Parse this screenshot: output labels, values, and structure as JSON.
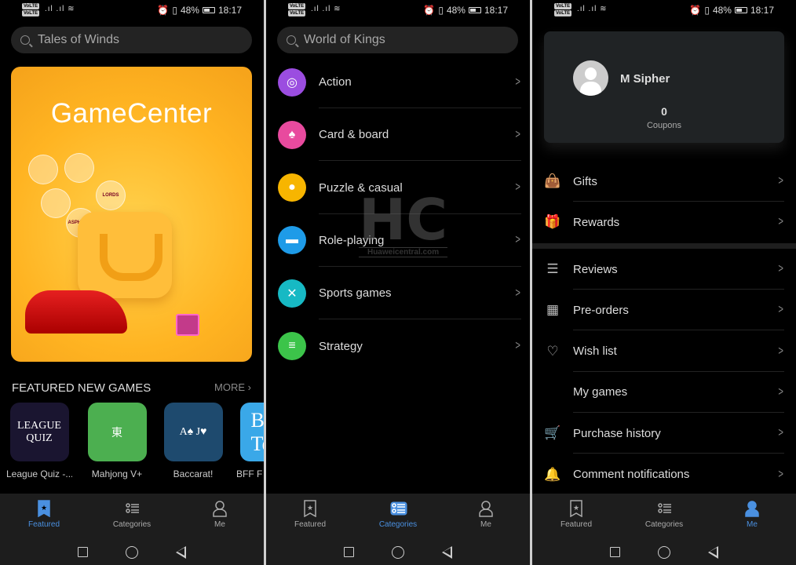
{
  "status": {
    "battery": "48%",
    "time": "18:17",
    "sim_labels": [
      "VoLTE",
      "VoLTE"
    ]
  },
  "featured": {
    "search_placeholder": "Tales of Winds",
    "banner_title": "GameCenter",
    "banner_bubbles": [
      "LORDS",
      "ASPHALT 9"
    ],
    "section_title": "FEATURED NEW GAMES",
    "more_label": "MORE",
    "games": [
      {
        "name": "League Quiz -...",
        "icon_text": [
          "LEAGUE",
          "QUIZ"
        ],
        "color": "#1a1530"
      },
      {
        "name": "Mahjong V+",
        "icon_text": [
          "東"
        ],
        "color": "#4caf50"
      },
      {
        "name": "Baccarat!",
        "icon_text": [
          "A♠ J♥"
        ],
        "color": "#1e4a6e"
      },
      {
        "name": "BFF F",
        "icon_text": [
          "B",
          "Te"
        ],
        "color": "#3aa8e8"
      }
    ]
  },
  "categories": {
    "search_placeholder": "World of Kings",
    "items": [
      {
        "label": "Action",
        "icon": "target-icon",
        "glyph": "◎",
        "color": "#9b4de0"
      },
      {
        "label": "Card & board",
        "icon": "card-icon",
        "glyph": "♠",
        "color": "#e84a9e"
      },
      {
        "label": "Puzzle & casual",
        "icon": "pacman-icon",
        "glyph": "●",
        "color": "#f7b500"
      },
      {
        "label": "Role-playing",
        "icon": "helmet-icon",
        "glyph": "▬",
        "color": "#1e9be8"
      },
      {
        "label": "Sports games",
        "icon": "basketball-icon",
        "glyph": "✕",
        "color": "#17b9c4"
      },
      {
        "label": "Strategy",
        "icon": "coins-icon",
        "glyph": "≡",
        "color": "#3cc44a"
      }
    ],
    "watermark": {
      "big": "HC",
      "small": "Huaweicentral.com"
    }
  },
  "me": {
    "user_name": "M Sipher",
    "coupons_count": "0",
    "coupons_label": "Coupons",
    "menu_group1": [
      {
        "label": "Gifts",
        "icon": "bag-icon",
        "glyph": "👜"
      },
      {
        "label": "Rewards",
        "icon": "gift-icon",
        "glyph": "🎁"
      }
    ],
    "menu_group2": [
      {
        "label": "Reviews",
        "icon": "comment-icon",
        "glyph": "☰"
      },
      {
        "label": "Pre-orders",
        "icon": "calendar-clock-icon",
        "glyph": "▦"
      },
      {
        "label": "Wish list",
        "icon": "heart-icon",
        "glyph": "♡"
      },
      {
        "label": "My games",
        "icon": "",
        "glyph": ""
      },
      {
        "label": "Purchase history",
        "icon": "cart-icon",
        "glyph": "🛒"
      },
      {
        "label": "Comment notifications",
        "icon": "bell-icon",
        "glyph": "🔔"
      }
    ]
  },
  "bottom_nav": {
    "items": [
      "Featured",
      "Categories",
      "Me"
    ],
    "accent": "#4a90e0"
  }
}
